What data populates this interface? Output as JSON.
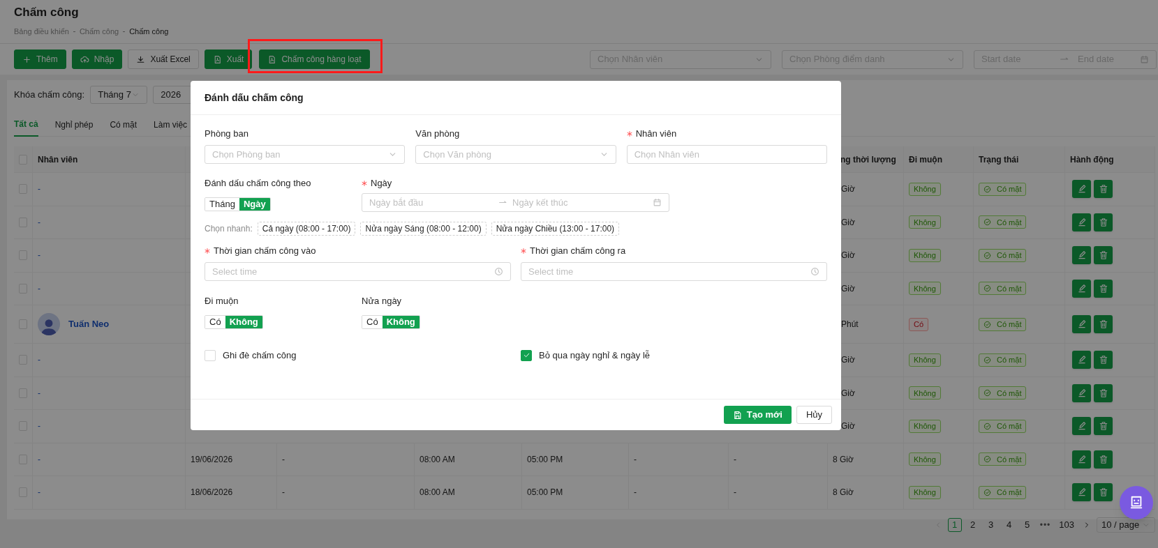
{
  "page": {
    "title": "Chấm công",
    "breadcrumb": [
      "Bảng điều khiển",
      "Chấm công",
      "Chấm công"
    ]
  },
  "toolbar": {
    "buttons": [
      {
        "label": "Thêm",
        "kind": "primary",
        "highlighted": false
      },
      {
        "label": "Nhập",
        "kind": "primary",
        "highlighted": false
      },
      {
        "label": "Xuất Excel",
        "kind": "outline",
        "highlighted": false
      },
      {
        "label": "Xuất",
        "kind": "primary",
        "highlighted": false
      },
      {
        "label": "Chấm công hàng loạt",
        "kind": "primary",
        "highlighted": true
      }
    ],
    "filters": [
      {
        "kind": "select",
        "placeholder": "Chọn Nhân viên"
      },
      {
        "kind": "select",
        "placeholder": "Chọn Phòng điểm danh"
      },
      {
        "kind": "date-range",
        "start_placeholder": "Start date",
        "end_placeholder": "End date"
      }
    ]
  },
  "lock": {
    "label": "Khóa chấm công:",
    "month": "Tháng 7",
    "year": "2026"
  },
  "tabs": [
    {
      "label": "Tất cả",
      "selected": true
    },
    {
      "label": "Nghỉ phép",
      "selected": false
    },
    {
      "label": "Có mặt",
      "selected": false
    },
    {
      "label": "Làm việc",
      "selected": false
    }
  ],
  "table": {
    "header_checked": false,
    "columns": {
      "employee": "Nhân viên",
      "duration": "ng thời lượng",
      "late": "Đi muộn",
      "status": "Trạng thái",
      "actions": "Hành động"
    },
    "rows": [
      {
        "checked": false,
        "employee": "-",
        "avatar": false,
        "duration": "Giờ",
        "late_label": "Không",
        "late": false,
        "status": "Có mặt"
      },
      {
        "checked": false,
        "employee": "-",
        "avatar": false,
        "duration": "Giờ",
        "late_label": "Không",
        "late": false,
        "status": "Có mặt"
      },
      {
        "checked": false,
        "employee": "-",
        "avatar": false,
        "duration": "Giờ",
        "late_label": "Không",
        "late": false,
        "status": "Có mặt"
      },
      {
        "checked": false,
        "employee": "-",
        "avatar": false,
        "duration": "Giờ",
        "late_label": "Không",
        "late": false,
        "status": "Có mặt"
      },
      {
        "checked": false,
        "employee": "Tuấn Neo",
        "avatar": true,
        "duration": "Phút",
        "late_label": "Có",
        "late": true,
        "status": "Có mặt"
      },
      {
        "checked": false,
        "employee": "-",
        "avatar": false,
        "duration": "Giờ",
        "late_label": "Không",
        "late": false,
        "status": "Có mặt"
      },
      {
        "checked": false,
        "employee": "-",
        "avatar": false,
        "duration": "Giờ",
        "late_label": "Không",
        "late": false,
        "status": "Có mặt"
      },
      {
        "checked": false,
        "employee": "-",
        "avatar": false,
        "duration": "Giờ",
        "late_label": "Không",
        "late": false,
        "status": "Có mặt"
      },
      {
        "checked": false,
        "employee": "-",
        "avatar": false,
        "date": "19/06/2026",
        "col_3": "-",
        "check_in": "08:00 AM",
        "check_out": "05:00 PM",
        "col_6": "-",
        "col_7": "-",
        "duration": "8 Giờ",
        "late_label": "Không",
        "late": false,
        "status": "Có mặt"
      },
      {
        "checked": false,
        "employee": "-",
        "avatar": false,
        "date": "18/06/2026",
        "col_3": "-",
        "check_in": "08:00 AM",
        "check_out": "05:00 PM",
        "col_6": "-",
        "col_7": "-",
        "duration": "8 Giờ",
        "late_label": "Không",
        "late": false,
        "status": "Có mặt"
      }
    ]
  },
  "pagination": {
    "prev_disabled": true,
    "pages": [
      {
        "label": "1",
        "selected": true
      },
      {
        "label": "2",
        "selected": false
      },
      {
        "label": "3",
        "selected": false
      },
      {
        "label": "4",
        "selected": false
      },
      {
        "label": "5",
        "selected": false
      }
    ],
    "ellipsis": "•••",
    "last": "103",
    "page_size": "10 / page"
  },
  "modal": {
    "title": "Đánh dấu chấm công",
    "fields": [
      {
        "label": "Phòng ban",
        "required": false,
        "kind": "select",
        "placeholder": "Chọn Phòng ban"
      },
      {
        "label": "Văn phòng",
        "required": false,
        "kind": "select",
        "placeholder": "Chọn Văn phòng"
      },
      {
        "label": "Nhân viên",
        "required": true,
        "kind": "input",
        "placeholder": "Chọn Nhân viên"
      }
    ],
    "mark_by": {
      "label": "Đánh dấu chấm công theo",
      "options": [
        {
          "label": "Tháng",
          "selected": false
        },
        {
          "label": "Ngày",
          "selected": true
        }
      ]
    },
    "date": {
      "label": "Ngày",
      "required": true,
      "start_placeholder": "Ngày bắt đầu",
      "end_placeholder": "Ngày kết thúc"
    },
    "quick": {
      "label": "Chọn nhanh:",
      "options": [
        "Cả ngày (08:00 - 17:00)",
        "Nửa ngày Sáng (08:00 - 12:00)",
        "Nửa ngày Chiều (13:00 - 17:00)"
      ]
    },
    "times": [
      {
        "label": "Thời gian chấm công vào",
        "required": true,
        "placeholder": "Select time"
      },
      {
        "label": "Thời gian chấm công ra",
        "required": true,
        "placeholder": "Select time"
      }
    ],
    "toggles": [
      {
        "label": "Đi muộn",
        "options": [
          {
            "label": "Có",
            "selected": false
          },
          {
            "label": "Không",
            "selected": true
          }
        ]
      },
      {
        "label": "Nửa ngày",
        "options": [
          {
            "label": "Có",
            "selected": false
          },
          {
            "label": "Không",
            "selected": true
          }
        ]
      }
    ],
    "checkboxes": [
      {
        "label": "Ghi đè chấm công",
        "checked": false
      },
      {
        "label": "Bỏ qua ngày nghỉ & ngày lễ",
        "checked": true
      }
    ],
    "buttons": [
      {
        "label": "Tạo mới",
        "kind": "primary"
      },
      {
        "label": "Hủy",
        "kind": "default"
      }
    ]
  }
}
